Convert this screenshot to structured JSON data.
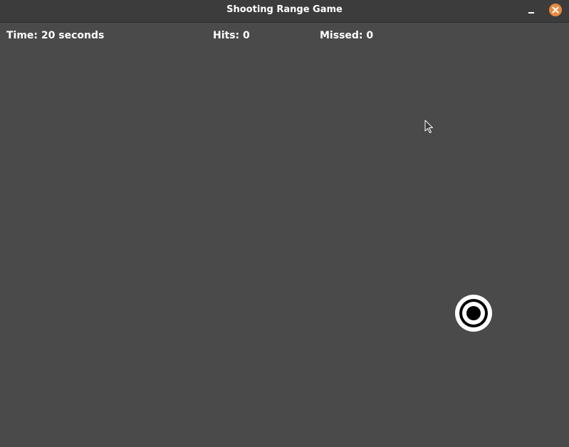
{
  "window": {
    "title": "Shooting Range Game"
  },
  "hud": {
    "time_label": "Time: 20 seconds",
    "hits_label": "Hits: 0",
    "missed_label": "Missed: 0"
  },
  "game": {
    "time_remaining_seconds": 20,
    "hits": 0,
    "missed": 0
  },
  "colors": {
    "background": "#4a4a4a",
    "titlebar": "#3c3c3c",
    "close_button": "#e9883d",
    "text": "#ffffff",
    "target_outer": "#ffffff",
    "target_ring": "#000000"
  },
  "icons": {
    "minimize": "minimize-icon",
    "close": "close-icon",
    "target": "bullseye-target-icon",
    "cursor": "mouse-pointer-icon"
  }
}
